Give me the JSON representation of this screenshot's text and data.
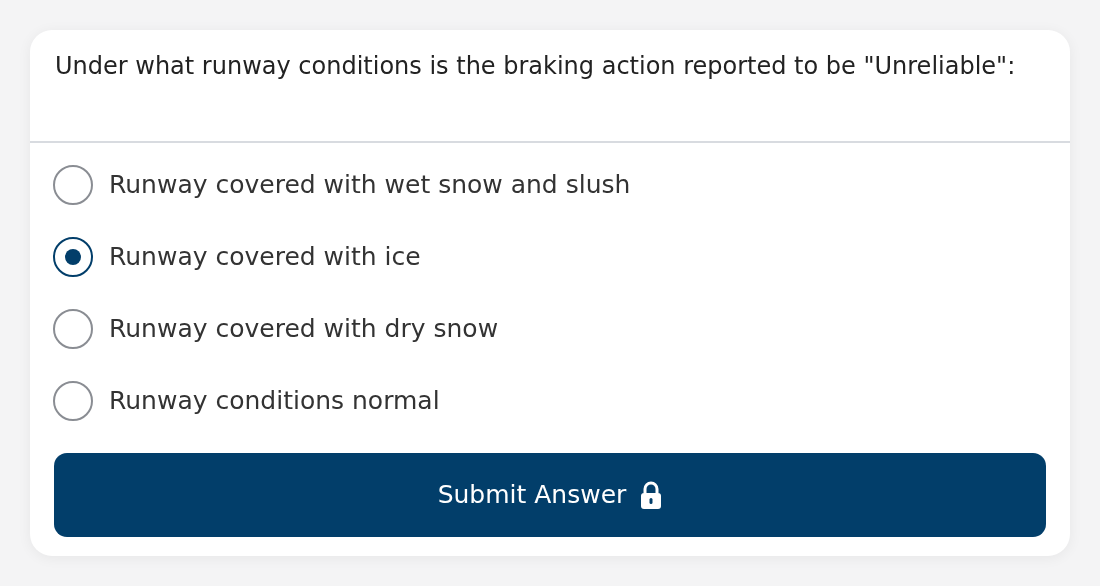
{
  "question": "Under what runway conditions is the braking action reported to be \"Unreliable\":",
  "options": [
    {
      "label": "Runway covered with wet snow and slush",
      "selected": false
    },
    {
      "label": "Runway covered with ice",
      "selected": true
    },
    {
      "label": "Runway covered with dry snow",
      "selected": false
    },
    {
      "label": "Runway conditions normal",
      "selected": false
    }
  ],
  "submit": {
    "label": "Submit Answer",
    "locked": true
  }
}
